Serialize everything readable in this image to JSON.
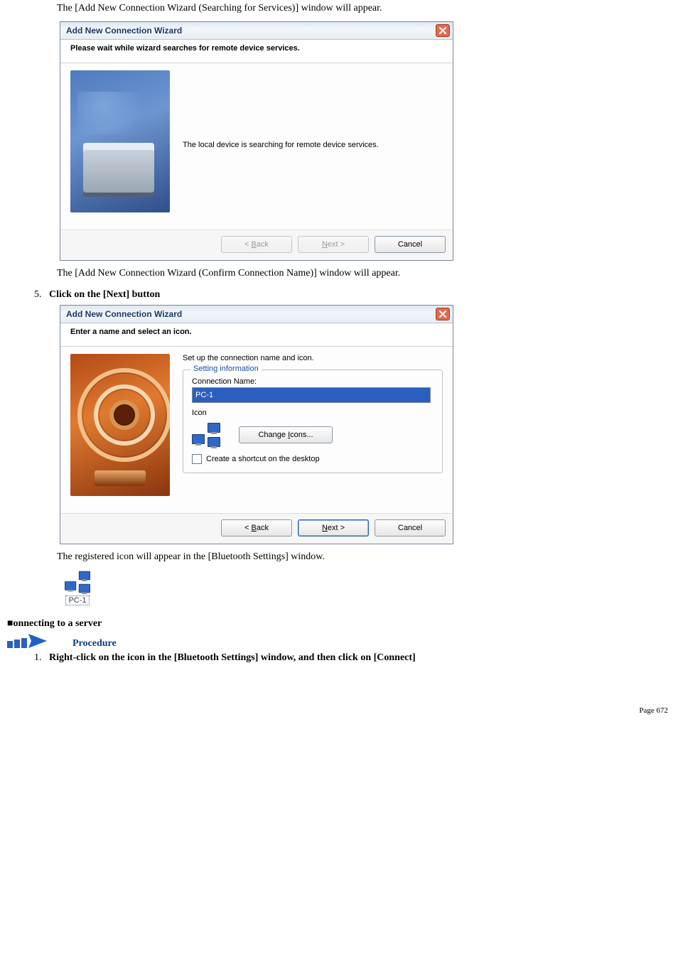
{
  "doc": {
    "intro1": "The [Add New Connection Wizard (Searching for Services)] window will appear.",
    "intro2": "The [Add New Connection Wizard (Confirm Connection Name)] window will appear.",
    "step5_label": "Click on the [Next] button",
    "after_dialog2": "The registered icon will appear in the [Bluetooth Settings] window.",
    "section_connect": "■onnecting to a server",
    "procedure": "Procedure",
    "step_connect": "Right-click on the icon in the [Bluetooth Settings] window, and then click on [Connect]",
    "page_footer": "Page 672",
    "bt_icon_label": "PC-1",
    "step5_number": "5.",
    "step_connect_number": "1."
  },
  "dialog1": {
    "title": "Add New Connection Wizard",
    "header": "Please wait while wizard searches for remote device services.",
    "body_text": "The local device is searching for remote device services.",
    "btn_back_pre": "< ",
    "btn_back_u": "B",
    "btn_back_post": "ack",
    "btn_next_u": "N",
    "btn_next_post": "ext >",
    "btn_cancel": "Cancel"
  },
  "dialog2": {
    "title": "Add New Connection Wizard",
    "header": "Enter a name and select an icon.",
    "lead": "Set up the connection name and icon.",
    "group_legend": "Setting information",
    "conn_label_u": "C",
    "conn_label_post": "onnection Name:",
    "conn_value": "PC-1",
    "icon_label": "Icon",
    "change_icons_pre": "Change ",
    "change_icons_u": "I",
    "change_icons_post": "cons...",
    "shortcut_pre": "Create a ",
    "shortcut_u": "s",
    "shortcut_post": "hortcut on the desktop",
    "btn_back_pre": "< ",
    "btn_back_u": "B",
    "btn_back_post": "ack",
    "btn_next_u": "N",
    "btn_next_post": "ext >",
    "btn_cancel": "Cancel"
  }
}
